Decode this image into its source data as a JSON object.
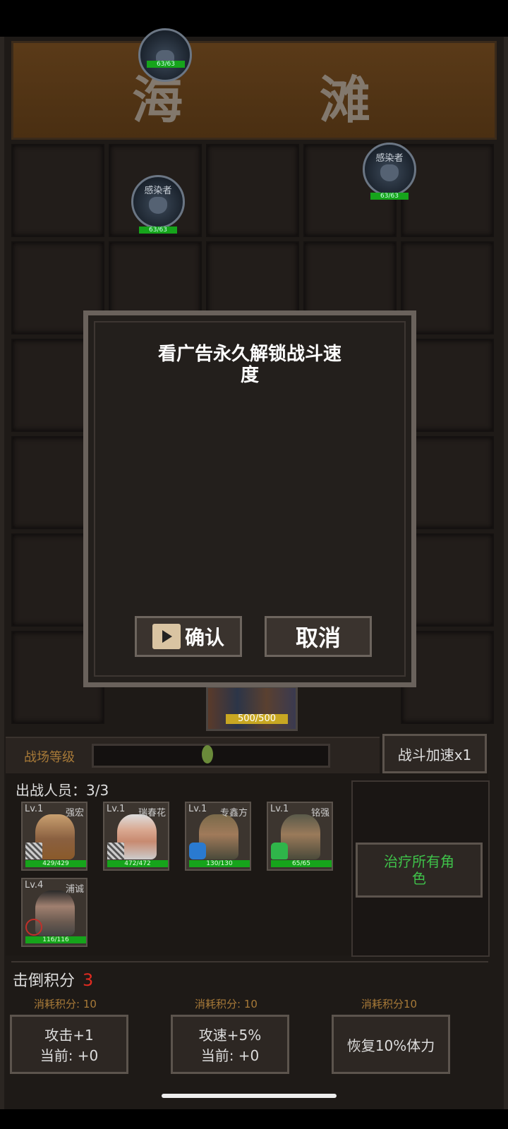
{
  "location": {
    "char1": "海",
    "char2": "滩"
  },
  "enemies": [
    {
      "name": "感染者",
      "hp": "63/63"
    },
    {
      "name": "感染者",
      "hp": "63/63"
    },
    {
      "name": "",
      "hp": "63/63"
    }
  ],
  "dialog": {
    "message": "看广告永久解锁战斗速度",
    "confirm_label": "确认",
    "cancel_label": "取消"
  },
  "base": {
    "hp": "500/500"
  },
  "battlefield": {
    "label": "战场等级",
    "speed_label": "战斗加速x1"
  },
  "party": {
    "title": "出战人员：",
    "count": "3/3",
    "heroes": [
      {
        "level": "Lv.1",
        "name": "强宏",
        "hp": "429/429"
      },
      {
        "level": "Lv.1",
        "name": "瑞春花",
        "hp": "472/472"
      },
      {
        "level": "Lv.1",
        "name": "专鑫方",
        "hp": "130/130"
      },
      {
        "level": "Lv.1",
        "name": "铭强",
        "hp": "65/65"
      },
      {
        "level": "Lv.4",
        "name": "浦诚",
        "hp": "116/116"
      }
    ],
    "heal_label": "治疗所有角色"
  },
  "score": {
    "label": "击倒积分",
    "value": "3"
  },
  "upgrades": [
    {
      "cost": "消耗积分: 10",
      "title": "攻击+1",
      "current": "当前: +0"
    },
    {
      "cost": "消耗积分: 10",
      "title": "攻速+5%",
      "current": "当前: +0"
    },
    {
      "cost": "消耗积分10",
      "title": "恢复10%体力",
      "current": ""
    }
  ],
  "colors": {
    "hp_green": "#16a41b",
    "score_red": "#e02b20",
    "heal_green": "#3fc24a",
    "cost_orange": "#a87a38"
  }
}
